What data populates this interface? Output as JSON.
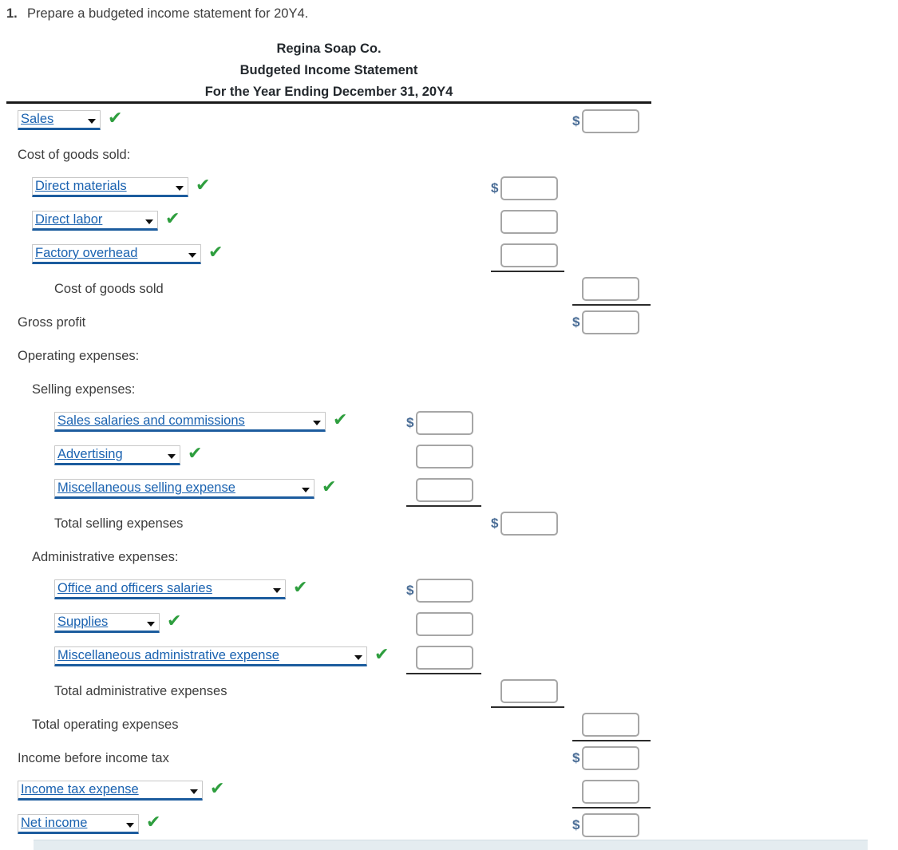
{
  "question": {
    "number": "1.",
    "text": "Prepare a budgeted income statement for 20Y4."
  },
  "statement": {
    "company": "Regina Soap Co.",
    "title": "Budgeted Income Statement",
    "period": "For the Year Ending December 31, 20Y4"
  },
  "symbols": {
    "dollar": "$",
    "check": "✔",
    "caret": "▼"
  },
  "rows": [
    {
      "kind": "select",
      "indent": 0,
      "label": "Sales",
      "select_width": 104,
      "check": true,
      "amount_column": 3,
      "dollar": true,
      "value": "",
      "placeholder": ""
    },
    {
      "kind": "label",
      "indent": 0,
      "label": "Cost of goods sold:"
    },
    {
      "kind": "select",
      "indent": 1,
      "label": "Direct materials",
      "select_width": 196,
      "check": true,
      "amount_column": 2,
      "dollar": true,
      "value": "",
      "placeholder": ""
    },
    {
      "kind": "select",
      "indent": 1,
      "label": "Direct labor",
      "select_width": 158,
      "check": true,
      "amount_column": 2,
      "dollar": false,
      "value": "",
      "placeholder": ""
    },
    {
      "kind": "select",
      "indent": 1,
      "label": "Factory overhead",
      "select_width": 212,
      "check": true,
      "amount_column": 2,
      "dollar": false,
      "value": "",
      "placeholder": "",
      "rule_after": 2
    },
    {
      "kind": "label",
      "indent": 2,
      "label": "Cost of goods sold",
      "amount_column": 3,
      "dollar": false,
      "value": "",
      "placeholder": "",
      "rule_after": 3
    },
    {
      "kind": "label",
      "indent": 0,
      "label": "Gross profit",
      "amount_column": 3,
      "dollar": true,
      "value": "",
      "placeholder": ""
    },
    {
      "kind": "label",
      "indent": 0,
      "label": "Operating expenses:"
    },
    {
      "kind": "label",
      "indent": 1,
      "label": "Selling expenses:"
    },
    {
      "kind": "select",
      "indent": 2,
      "label": "Sales salaries and commissions",
      "select_width": 340,
      "check": true,
      "amount_column": 1,
      "dollar": true,
      "value": "",
      "placeholder": ""
    },
    {
      "kind": "select",
      "indent": 2,
      "label": "Advertising",
      "select_width": 158,
      "check": true,
      "amount_column": 1,
      "dollar": false,
      "value": "",
      "placeholder": ""
    },
    {
      "kind": "select",
      "indent": 2,
      "label": "Miscellaneous selling expense",
      "select_width": 326,
      "check": true,
      "amount_column": 1,
      "dollar": false,
      "value": "",
      "placeholder": "",
      "rule_after": 1
    },
    {
      "kind": "label",
      "indent": 2,
      "label": "Total selling expenses",
      "amount_column": 2,
      "dollar": true,
      "value": "",
      "placeholder": ""
    },
    {
      "kind": "label",
      "indent": 1,
      "label": "Administrative expenses:"
    },
    {
      "kind": "select",
      "indent": 2,
      "label": "Office and officers salaries",
      "select_width": 290,
      "check": true,
      "amount_column": 1,
      "dollar": true,
      "value": "",
      "placeholder": ""
    },
    {
      "kind": "select",
      "indent": 2,
      "label": "Supplies",
      "select_width": 132,
      "check": true,
      "amount_column": 1,
      "dollar": false,
      "value": "",
      "placeholder": ""
    },
    {
      "kind": "select",
      "indent": 2,
      "label": "Miscellaneous administrative expense",
      "select_width": 392,
      "check": true,
      "amount_column": 1,
      "dollar": false,
      "value": "",
      "placeholder": "",
      "rule_after": 1
    },
    {
      "kind": "label",
      "indent": 2,
      "label": "Total administrative expenses",
      "amount_column": 2,
      "dollar": false,
      "value": "",
      "placeholder": "",
      "rule_after": 2
    },
    {
      "kind": "label",
      "indent": 1,
      "label": "Total operating expenses",
      "amount_column": 3,
      "dollar": false,
      "value": "",
      "placeholder": "",
      "rule_after": 3
    },
    {
      "kind": "label",
      "indent": 0,
      "label": "Income before income tax",
      "amount_column": 3,
      "dollar": true,
      "value": "",
      "placeholder": ""
    },
    {
      "kind": "select",
      "indent": 0,
      "label": "Income tax expense",
      "select_width": 232,
      "check": true,
      "amount_column": 3,
      "dollar": false,
      "value": "",
      "placeholder": "",
      "rule_after": 3
    },
    {
      "kind": "select",
      "indent": 0,
      "label": "Net income",
      "select_width": 152,
      "check": true,
      "amount_column": 3,
      "dollar": true,
      "value": "",
      "placeholder": "",
      "double_rule_after": 3
    }
  ]
}
